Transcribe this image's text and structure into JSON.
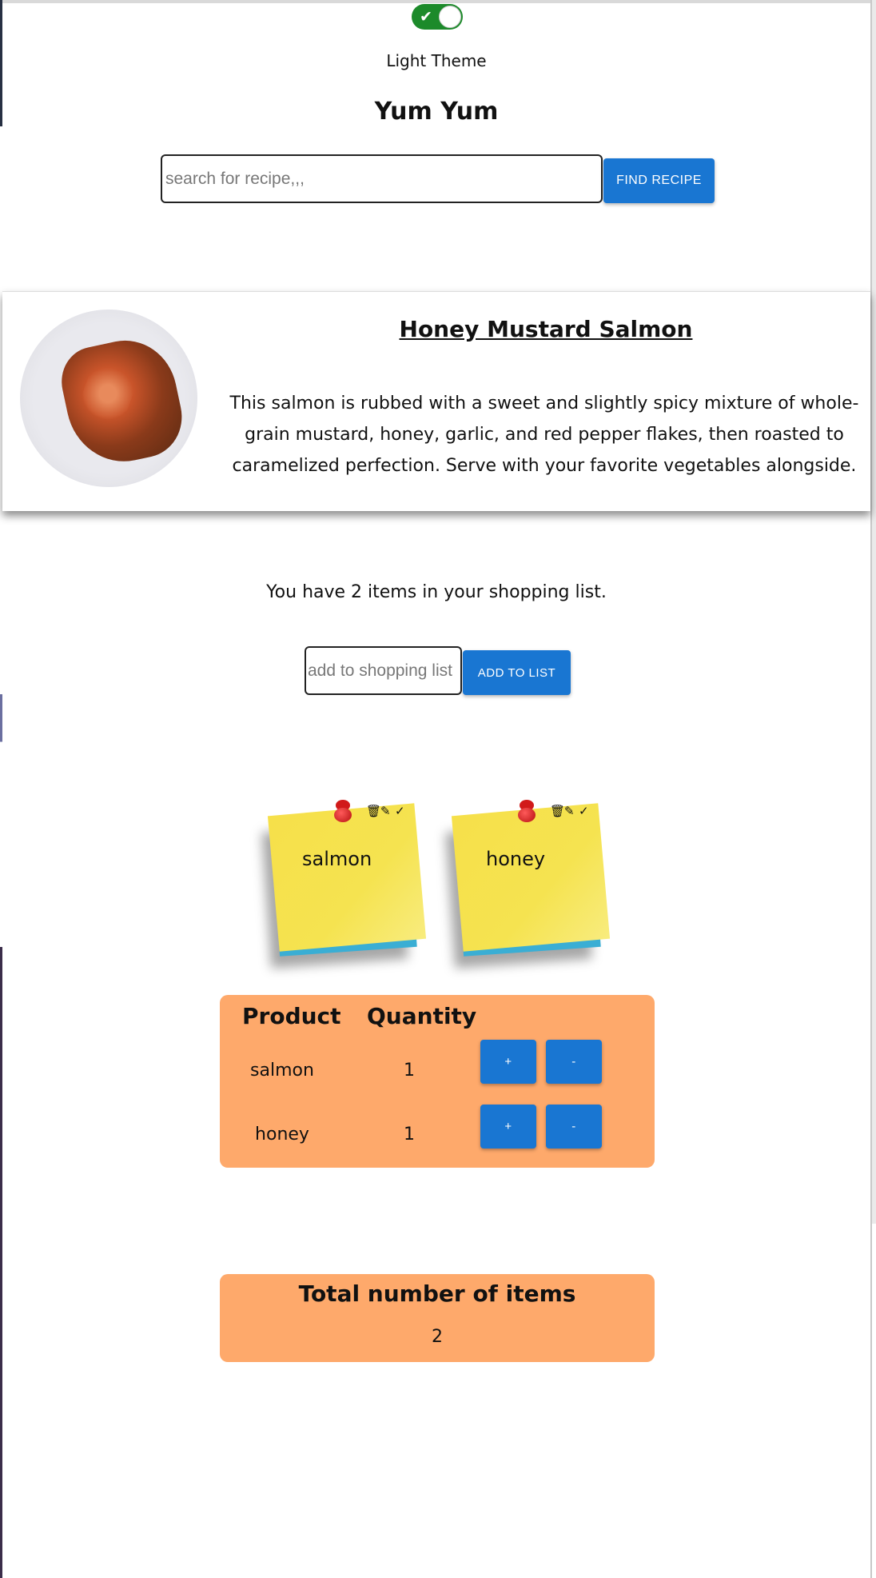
{
  "theme_toggle": {
    "label": "Light Theme",
    "checked": true,
    "icon": "check-icon"
  },
  "app": {
    "title": "Yum Yum"
  },
  "search": {
    "placeholder": "search for recipe,,,",
    "button_label": "FIND RECIPE"
  },
  "recipe": {
    "title": "Honey Mustard Salmon",
    "description": "This salmon is rubbed with a sweet and slightly spicy mixture of whole-grain mustard, honey, garlic, and red pepper flakes, then roasted to caramelized perfection. Serve with your favorite vegetables alongside."
  },
  "shopping": {
    "count_text": "You have 2 items in your shopping list.",
    "add_placeholder": "add to shopping list",
    "add_button_label": "ADD TO LIST"
  },
  "notes": [
    {
      "label": "salmon"
    },
    {
      "label": "honey"
    }
  ],
  "note_icons": {
    "delete": "🗑",
    "edit": "✎",
    "done": "✓"
  },
  "table": {
    "headers": {
      "product": "Product",
      "quantity": "Quantity"
    },
    "rows": [
      {
        "product": "salmon",
        "quantity": "1",
        "plus": "+",
        "minus": "-"
      },
      {
        "product": "honey",
        "quantity": "1",
        "plus": "+",
        "minus": "-"
      }
    ]
  },
  "total": {
    "title": "Total number of items",
    "value": "2"
  },
  "colors": {
    "accent_blue": "#1976d2",
    "toggle_green": "#1c8a2a",
    "panel_orange": "#fea96b",
    "note_yellow": "#f6e04a",
    "note_blue": "#3aaed4"
  }
}
